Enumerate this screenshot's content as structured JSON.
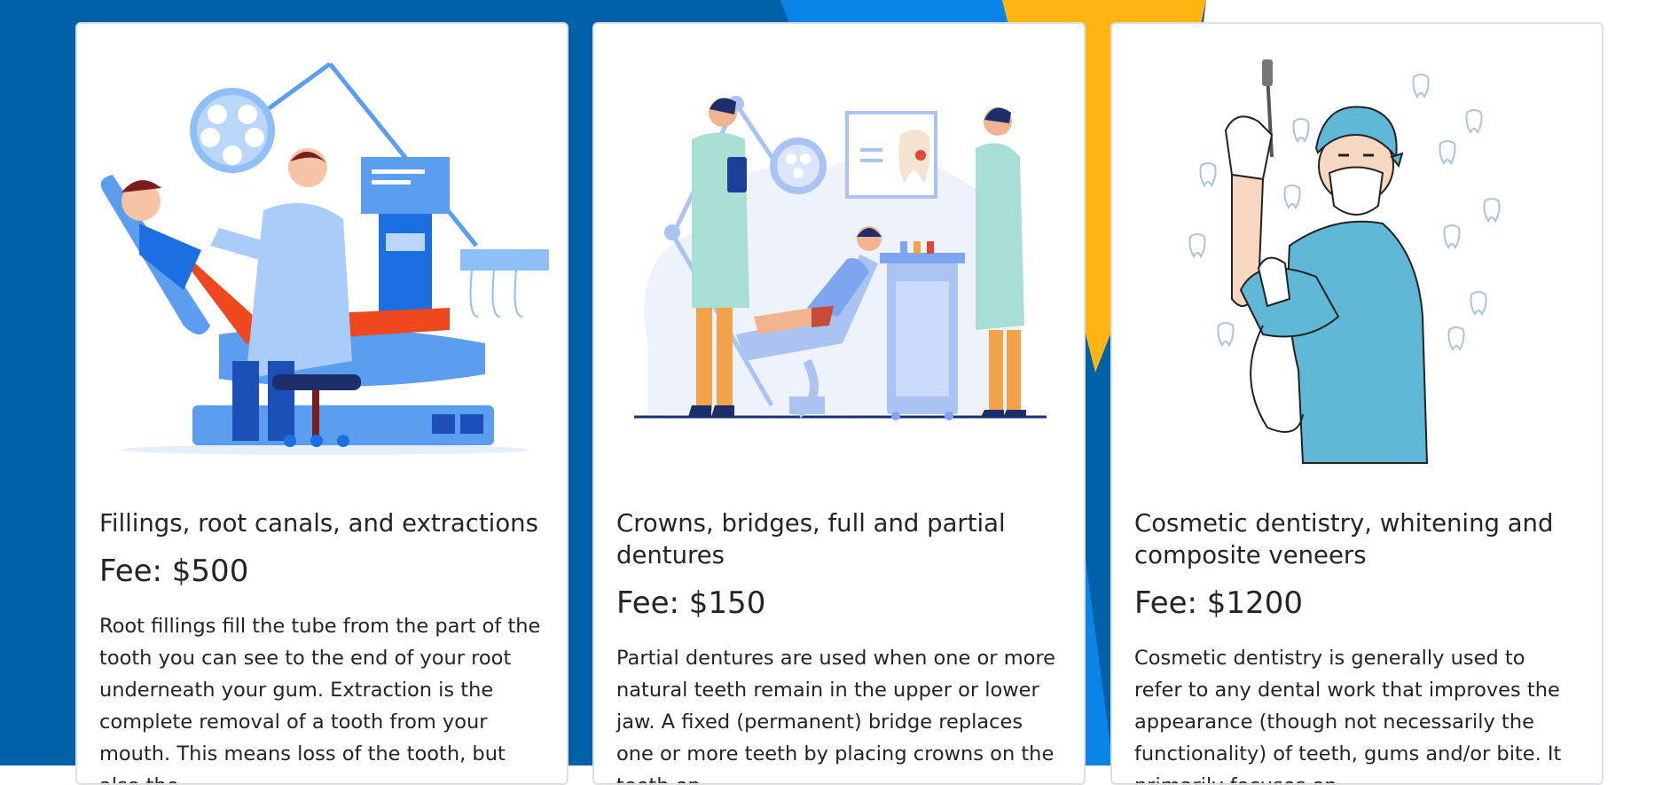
{
  "colors": {
    "primary_blue": "#0061a8",
    "bright_blue": "#0a84e6",
    "accent_yellow": "#ffb511",
    "card_border": "#dcdfe3"
  },
  "services": [
    {
      "title": "Fillings, root canals, and extractions",
      "fee": "Fee: $500",
      "description": "Root fillings fill the tube from the part of the tooth you can see to the end of your root underneath your gum. Extraction is the complete removal of a tooth from your mouth. This means loss of the tooth, but also the",
      "illustration": "dentist-treating-patient-in-chair-illustration"
    },
    {
      "title": "Crowns, bridges, full and partial dentures",
      "fee": "Fee: $150",
      "description": "Partial dentures are used when one or more natural teeth remain in the upper or lower jaw. A fixed (permanent) bridge replaces one or more teeth by placing crowns on the teeth on",
      "illustration": "dental-clinic-staff-and-patient-illustration"
    },
    {
      "title": "Cosmetic dentistry, whitening and composite veneers",
      "fee": "Fee: $1200",
      "description": "Cosmetic dentistry is generally used to refer to any dental work that improves the appearance (though not necessarily the functionality) of teeth, gums and/or bite. It primarily focuses on",
      "illustration": "dentist-in-scrubs-holding-tool-illustration"
    }
  ]
}
